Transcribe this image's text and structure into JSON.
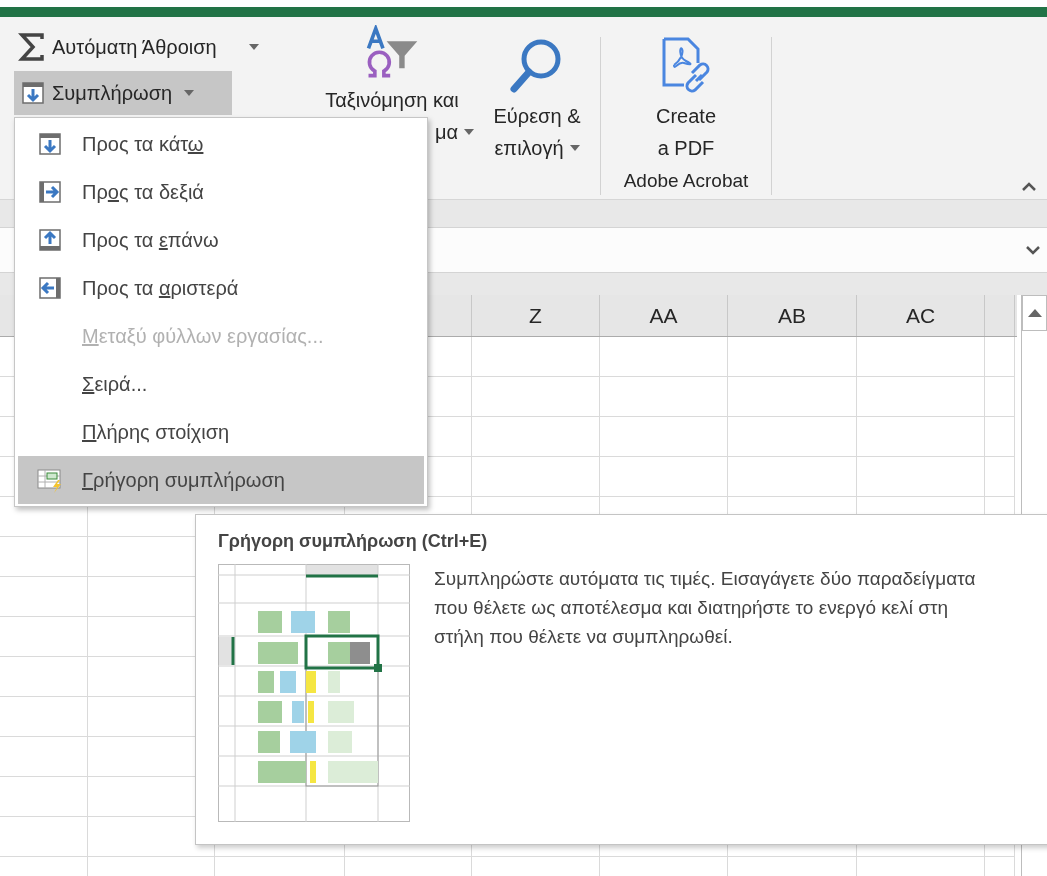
{
  "ribbon": {
    "autosum": {
      "label": "Αυτόματη Άθροιση"
    },
    "fill": {
      "label": "Συμπλήρωση",
      "expanded": true
    },
    "sort_filter": {
      "label_line_1": "Ταξινόμηση και",
      "label_line_2": "μα"
    },
    "find_select": {
      "label_line_1": "Εύρεση &",
      "label_line_2": "επιλογή"
    },
    "create_pdf": {
      "label_line_1": "Create",
      "label_line_2": "a PDF"
    },
    "group_label": "Adobe Acrobat"
  },
  "sheet": {
    "columns": [
      "Z",
      "AA",
      "AB",
      "AC"
    ]
  },
  "fill_menu": {
    "items": [
      {
        "kind": "down",
        "label_start": "Προς τα κάτ",
        "access_key": "ω",
        "disabled": false,
        "selected": false
      },
      {
        "kind": "right",
        "label_start": "Πρ",
        "access_key": "ο",
        "label_end": "ς τα δεξιά",
        "disabled": false,
        "selected": false
      },
      {
        "kind": "up",
        "label_start": "Προς τα ",
        "access_key": "ε",
        "label_end": "πάνω",
        "disabled": false,
        "selected": false
      },
      {
        "kind": "left",
        "label_start": "Προς τα ",
        "access_key": "α",
        "label_end": "ριστερά",
        "disabled": false,
        "selected": false
      },
      {
        "kind": "none",
        "access_key": "Μ",
        "label_end": "εταξύ φύλλων εργασίας...",
        "disabled": true,
        "selected": false
      },
      {
        "kind": "none",
        "access_key": "Σ",
        "label_end": "ειρά...",
        "disabled": false,
        "selected": false
      },
      {
        "kind": "none",
        "access_key": "Π",
        "label_end": "λήρης στοίχιση",
        "disabled": false,
        "selected": false
      },
      {
        "kind": "flash",
        "access_key": "Γ",
        "label_end": "ρήγορη συμπλήρωση",
        "disabled": false,
        "selected": true
      }
    ]
  },
  "tooltip": {
    "title": "Γρήγορη συμπλήρωση (Ctrl+E)",
    "description": "Συμπληρώστε αυτόματα τις τιμές. Εισαγάγετε δύο παραδείγματα που θέλετε ως αποτέλεσμα και διατηρήστε το ενεργό κελί στη στήλη που θέλετε να συμπληρωθεί."
  }
}
